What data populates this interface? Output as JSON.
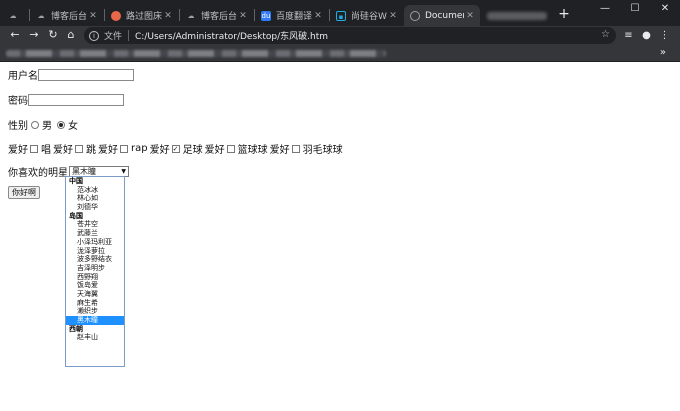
{
  "browser": {
    "tabs": [
      {
        "title": "博客后台 - 我",
        "icon": "cloud-icon",
        "icon_color": "#9aa0a6"
      },
      {
        "title": "路过图床 - 免",
        "icon": "butterfly-icon",
        "icon_color": "#e8674a"
      },
      {
        "title": "博客后台 - 我",
        "icon": "cloud-icon",
        "icon_color": "#9aa0a6"
      },
      {
        "title": "百度翻译",
        "icon": "translate-icon",
        "icon_color": "#2f7cf6"
      },
      {
        "title": "尚硅谷Web",
        "icon": "bilibili-icon",
        "icon_color": "#23ade5"
      },
      {
        "title": "Document",
        "icon": "globe-icon",
        "icon_color": "#9aa0a6",
        "active": true
      }
    ],
    "url_label": "文件",
    "url": "C:/Users/Administrator/Desktop/东风破.htm"
  },
  "form": {
    "username_label": "用户名",
    "password_label": "密码",
    "gender_label": "性别",
    "gender_options": [
      {
        "label": "男",
        "checked": false
      },
      {
        "label": "女",
        "checked": true
      }
    ],
    "hobbies": [
      {
        "prefix": "爱好",
        "label": "唱",
        "checked": false
      },
      {
        "prefix": "爱好",
        "label": "跳",
        "checked": false
      },
      {
        "prefix": "爱好",
        "label": "rap",
        "checked": false
      },
      {
        "prefix": "爱好",
        "label": "足球",
        "checked": true
      },
      {
        "prefix": "爱好",
        "label": "篮球球",
        "checked": false
      },
      {
        "prefix": "爱好",
        "label": "羽毛球球",
        "checked": false
      }
    ],
    "star_label": "你喜欢的明星",
    "star_selected": "黑木瞳",
    "submit_label": "你好啊"
  },
  "dropdown": [
    {
      "group": "中国",
      "options": [
        "范冰冰",
        "林心如",
        "刘德华"
      ]
    },
    {
      "group": "岛国",
      "options": [
        "苍井空",
        "武藤兰",
        "小泽玛利亚",
        "泷泽萝拉",
        "波多野结衣",
        "吉泽明步",
        "西野翔",
        "饭岛爱",
        "天海翼",
        "麻生希",
        "濑织步",
        "黑木瞳"
      ]
    },
    {
      "group": "西朝",
      "options": [
        "赵丰山"
      ]
    }
  ]
}
